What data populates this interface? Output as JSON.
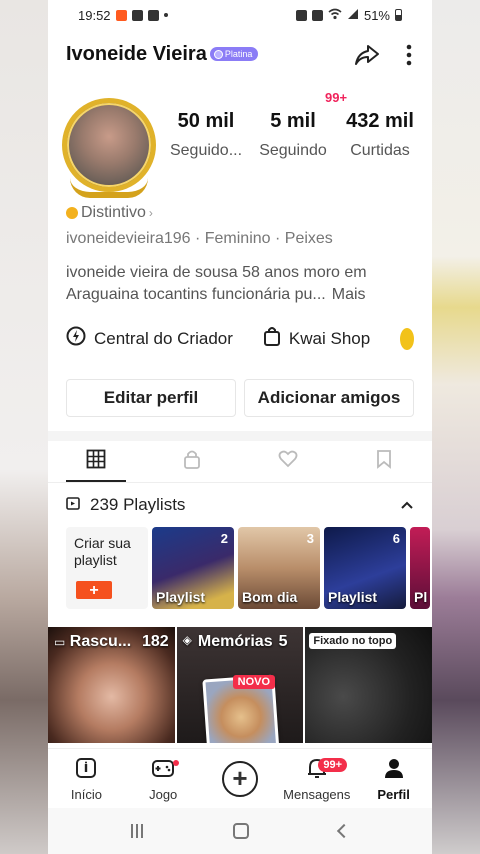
{
  "status_bar": {
    "time": "19:52",
    "battery": "51%"
  },
  "header": {
    "username": "Ivoneide Vieira",
    "badge": "Platina"
  },
  "profile": {
    "notif_badge": "99+",
    "stats": [
      {
        "value": "50 mil",
        "label": "Seguido..."
      },
      {
        "value": "5 mil",
        "label": "Seguindo"
      },
      {
        "value": "432 mil",
        "label": "Curtidas"
      }
    ],
    "distintivo": "Distintivo",
    "info": "ivoneidevieira196 · Feminino · Peixes",
    "bio": "ivoneide vieira de sousa 58 anos moro em Araguaina tocantins  funcionária pu...",
    "bio_more": "Mais"
  },
  "links": [
    {
      "label": "Central do Criador",
      "icon": "bolt-icon"
    },
    {
      "label": "Kwai Shop",
      "icon": "shopping-bag-icon"
    }
  ],
  "buttons": {
    "edit": "Editar perfil",
    "add_friends": "Adicionar amigos"
  },
  "playlists": {
    "title": "239 Playlists",
    "create_label": "Criar sua playlist",
    "create_plus": "+",
    "items": [
      {
        "name": "Playlist",
        "count": "2"
      },
      {
        "name": "Bom dia",
        "count": "3"
      },
      {
        "name": "Playlist",
        "count": "6"
      },
      {
        "name": "Pl",
        "count": ""
      }
    ]
  },
  "grid": [
    {
      "label": "Rascu...",
      "count": "182"
    },
    {
      "label": "Memórias",
      "count": "5",
      "new_badge": "NOVO"
    },
    {
      "pinned": "Fixado no topo"
    }
  ],
  "bottom_nav": [
    {
      "label": "Início",
      "icon": "home-icon"
    },
    {
      "label": "Jogo",
      "icon": "gamepad-icon"
    },
    {
      "label": "",
      "icon": "plus-icon"
    },
    {
      "label": "Mensagens",
      "icon": "bell-icon",
      "badge": "99+"
    },
    {
      "label": "Perfil",
      "icon": "person-icon"
    }
  ],
  "colors": {
    "accent": "#f5511e",
    "badge_red": "#f32e4a",
    "platina": "#8b7cf6"
  }
}
